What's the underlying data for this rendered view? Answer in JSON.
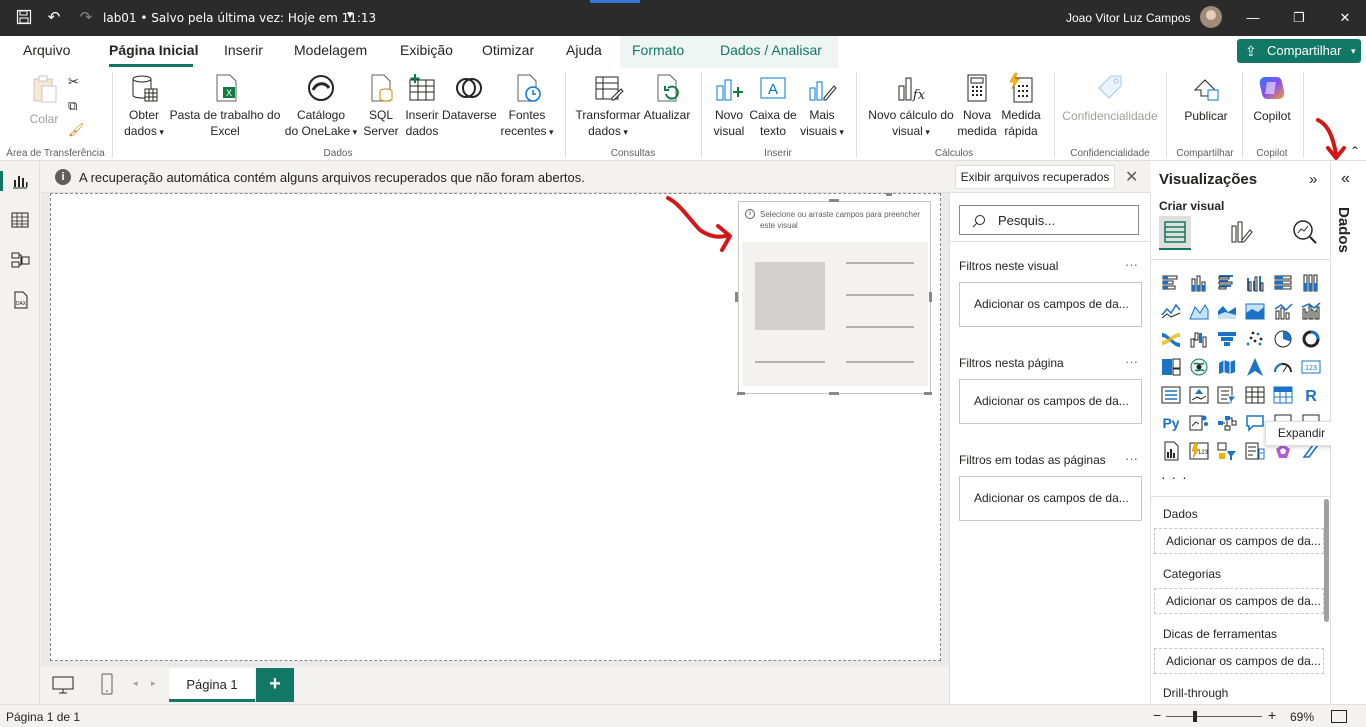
{
  "titlebar": {
    "file_title": "lab01 • Salvo pela última vez: Hoje em 11:13",
    "user_name": "Joao Vitor Luz Campos"
  },
  "menu": {
    "items": [
      "Arquivo",
      "Página Inicial",
      "Inserir",
      "Modelagem",
      "Exibição",
      "Otimizar",
      "Ajuda",
      "Formato",
      "Dados / Analisar"
    ],
    "active": "Página Inicial",
    "share_label": "Compartilhar"
  },
  "ribbon": {
    "paste": "Colar",
    "clipboard_group": "Área de Transferência",
    "get_data": [
      "Obter",
      "dados"
    ],
    "excel": [
      "Pasta de trabalho do",
      "Excel"
    ],
    "onelake": [
      "Catálogo",
      "do OneLake"
    ],
    "sql": [
      "SQL",
      "Server"
    ],
    "enter_data": [
      "Inserir",
      "dados"
    ],
    "dataverse": "Dataverse",
    "recent_sources": [
      "Fontes",
      "recentes"
    ],
    "data_group": "Dados",
    "transform": [
      "Transformar",
      "dados"
    ],
    "refresh": "Atualizar",
    "queries_group": "Consultas",
    "new_visual": [
      "Novo",
      "visual"
    ],
    "text_box": [
      "Caixa de",
      "texto"
    ],
    "more_visuals": [
      "Mais",
      "visuais"
    ],
    "insert_group": "Inserir",
    "new_calc": [
      "Novo cálculo do",
      "visual"
    ],
    "new_measure": [
      "Nova",
      "medida"
    ],
    "quick_measure": [
      "Medida",
      "rápida"
    ],
    "calcs_group": "Cálculos",
    "sensitivity": "Confidencialidade",
    "sensitivity_group": "Confidencialidade",
    "publish": "Publicar",
    "share_group": "Compartilhar",
    "copilot": "Copilot",
    "copilot_group": "Copilot"
  },
  "infobar": {
    "message": "A recuperação automática contém alguns arquivos recuperados que não foram abertos.",
    "button": "Exibir arquivos recuperados"
  },
  "visual_placeholder": {
    "message": "Selecione ou arraste campos para preencher este visual"
  },
  "filters": {
    "search_placeholder": "Pesquis...",
    "sections": [
      {
        "title": "Filtros neste visual",
        "well": "Adicionar os campos de da..."
      },
      {
        "title": "Filtros nesta página",
        "well": "Adicionar os campos de da..."
      },
      {
        "title": "Filtros em todas as páginas",
        "well": "Adicionar os campos de da..."
      }
    ]
  },
  "visualizations": {
    "title": "Visualizações",
    "build_label": "Criar visual",
    "wells": [
      {
        "title": "Dados",
        "well": "Adicionar os campos de da..."
      },
      {
        "title": "Categorias",
        "well": "Adicionar os campos de da..."
      },
      {
        "title": "Dicas de ferramentas",
        "well": "Adicionar os campos de da..."
      }
    ],
    "drillthrough": "Drill-through",
    "tooltip": "Expandir",
    "icons": [
      "stacked-bar",
      "stacked-column",
      "clustered-bar",
      "clustered-column",
      "100-bar",
      "100-column",
      "line",
      "area",
      "stacked-area",
      "100-area",
      "line-column",
      "line-clustered",
      "ribbon",
      "waterfall",
      "funnel",
      "scatter",
      "pie",
      "donut",
      "treemap",
      "map",
      "filled-map",
      "azure-map",
      "gauge",
      "card",
      "multi-row-card",
      "kpi",
      "slicer",
      "table",
      "matrix",
      "r-visual",
      "python-visual",
      "key-influencers",
      "decomposition-tree",
      "qa",
      "narrative",
      "paginated",
      "power-apps",
      "card-new",
      "slicer-new",
      "power-automate",
      "metrics",
      "custom"
    ]
  },
  "dados_pane": {
    "label": "Dados"
  },
  "pages": {
    "tab": "Página 1"
  },
  "status": {
    "page_of": "Página 1 de 1",
    "zoom": "69%",
    "zoom_fraction": 0.3
  },
  "colors": {
    "accent": "#117865",
    "titlebar": "#2b2b2b",
    "annotation": "#d41616"
  }
}
